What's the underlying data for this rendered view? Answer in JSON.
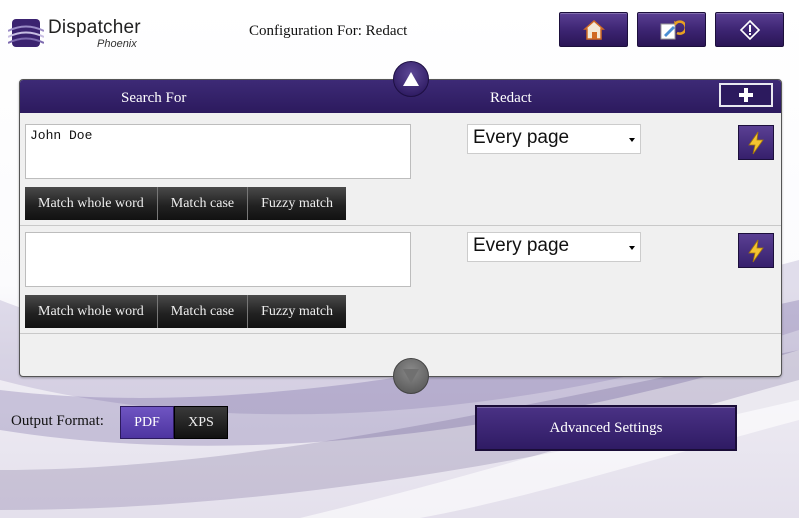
{
  "header": {
    "brand": "Dispatcher",
    "brand_sub": "Phoenix",
    "config_title": "Configuration For: Redact",
    "buttons": [
      {
        "name": "home-button",
        "icon": "home-icon"
      },
      {
        "name": "edit-config-button",
        "icon": "edit-icon"
      },
      {
        "name": "info-button",
        "icon": "info-icon"
      }
    ]
  },
  "table": {
    "col_search": "Search For",
    "col_redact": "Redact",
    "rows": [
      {
        "search_value": "John Doe",
        "options": [
          "Match whole word",
          "Match case",
          "Fuzzy match"
        ],
        "redact": "Every page"
      },
      {
        "search_value": "",
        "options": [
          "Match whole word",
          "Match case",
          "Fuzzy match"
        ],
        "redact": "Every page"
      }
    ]
  },
  "output": {
    "label": "Output Format:",
    "formats": [
      "PDF",
      "XPS"
    ],
    "selected": "PDF"
  },
  "advanced_label": "Advanced Settings",
  "colors": {
    "accent": "#2c1a5e",
    "accent_light": "#5a3f93",
    "bolt": "#f4c431"
  }
}
